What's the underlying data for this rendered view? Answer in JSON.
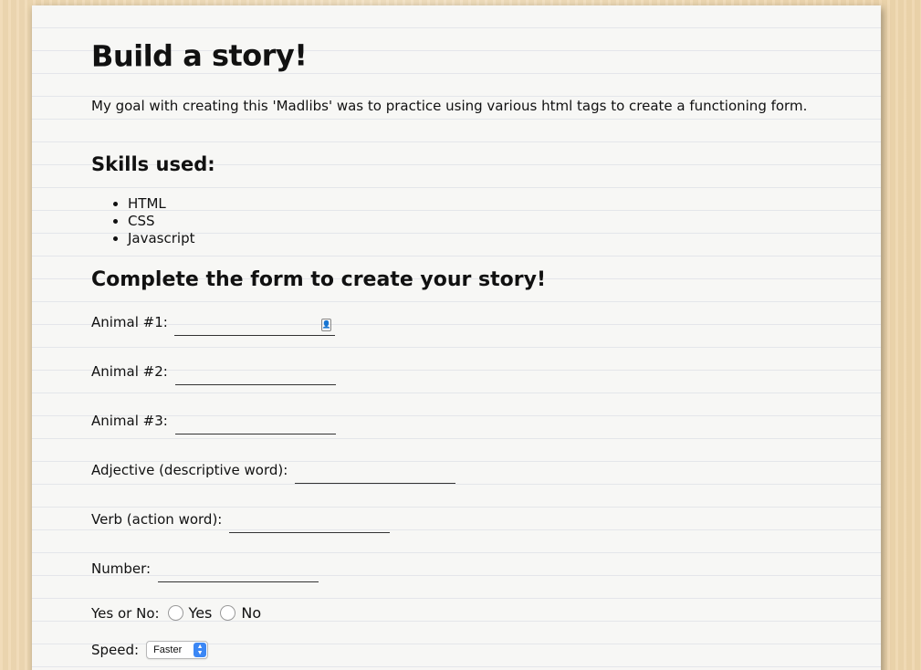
{
  "page": {
    "title": "Build a story!",
    "intro": "My goal with creating this 'Madlibs' was to practice using various html tags to create a functioning form.",
    "skills_heading": "Skills used:",
    "skills": [
      "HTML",
      "CSS",
      "Javascript"
    ],
    "form_heading": "Complete the form to create your story!"
  },
  "form": {
    "animal1_label": "Animal #1:",
    "animal1_value": "",
    "animal2_label": "Animal #2:",
    "animal2_value": "",
    "animal3_label": "Animal #3:",
    "animal3_value": "",
    "adjective_label": "Adjective (descriptive word):",
    "adjective_value": "",
    "verb_label": "Verb (action word):",
    "verb_value": "",
    "number_label": "Number:",
    "number_value": "",
    "yes_no_label": "Yes or No:",
    "yes_label": "Yes",
    "no_label": "No",
    "speed_label": "Speed:",
    "speed_selected": "Faster"
  },
  "colors": {
    "desk": "#f1dcb8",
    "paper": "#f7f7f5",
    "rule_lines": "#e4e6ea",
    "select_accent": "#3b87f5"
  },
  "icons": {
    "contact_autofill": "contact-card-icon",
    "select_arrows": "up-down-chevron-icon"
  }
}
